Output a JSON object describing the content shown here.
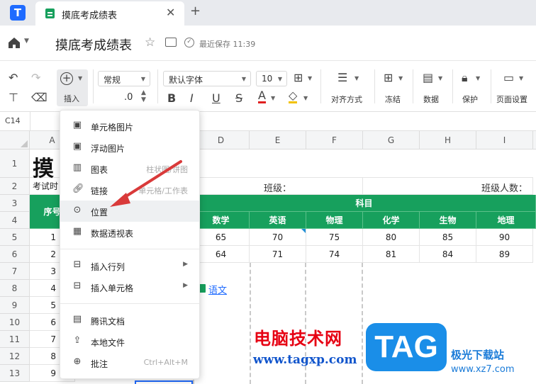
{
  "tab": {
    "title": "摸底考成绩表"
  },
  "header": {
    "title": "摸底考成绩表",
    "save_status": "最近保存 11:39"
  },
  "toolbar": {
    "insert_label": "插入",
    "number_format": "常规",
    "decimal": ".0",
    "font_family": "默认字体",
    "font_size": "10",
    "align_label": "对齐方式",
    "freeze_label": "冻结",
    "data_label": "数据",
    "protect_label": "保护",
    "page_setup_label": "页面设置",
    "bold": "B",
    "italic": "I",
    "underline": "U",
    "strike": "S",
    "font_color": "A"
  },
  "formula": {
    "cell_ref": "C14"
  },
  "columns": [
    "A",
    "D",
    "E",
    "F",
    "G",
    "H",
    "I"
  ],
  "rows": [
    "1",
    "2",
    "3",
    "4",
    "5",
    "6",
    "7",
    "8",
    "9",
    "10",
    "11",
    "12",
    "13"
  ],
  "sheet": {
    "a1": "摸",
    "a2": "考试时",
    "e2": "班级：",
    "i2": "班级人数：",
    "a3": "序号",
    "subject_header": "科目",
    "subjects": [
      "数学",
      "英语",
      "物理",
      "化学",
      "生物",
      "地理"
    ],
    "row5": [
      "65",
      "70",
      "75",
      "80",
      "85",
      "90"
    ],
    "row6": [
      "64",
      "71",
      "74",
      "81",
      "84",
      "89"
    ],
    "index": [
      "1",
      "2",
      "3",
      "4",
      "5",
      "6",
      "7",
      "8",
      "9"
    ],
    "link_text": "语文"
  },
  "menu": {
    "items": [
      {
        "label": "单元格图片",
        "hint": ""
      },
      {
        "label": "浮动图片",
        "hint": ""
      },
      {
        "label": "图表",
        "hint": "柱状图/饼图"
      },
      {
        "label": "链接",
        "hint": "单元格/工作表"
      },
      {
        "label": "位置",
        "hint": ""
      },
      {
        "label": "数据透视表",
        "hint": ""
      },
      {
        "label": "插入行列",
        "hint": ""
      },
      {
        "label": "插入单元格",
        "hint": ""
      },
      {
        "label": "腾讯文档",
        "hint": ""
      },
      {
        "label": "本地文件",
        "hint": ""
      },
      {
        "label": "批注",
        "hint": "Ctrl+Alt+M"
      }
    ]
  },
  "watermark": {
    "site_cn": "电脑技术网",
    "site_url": "www.tagxp.com",
    "badge": "TAG",
    "brand2": "极光下载站",
    "brand2_url": "www.xz7.com"
  },
  "colors": {
    "accent_green": "#17a05d",
    "brand_blue": "#1f6bff",
    "arrow_red": "#d93a3a"
  }
}
